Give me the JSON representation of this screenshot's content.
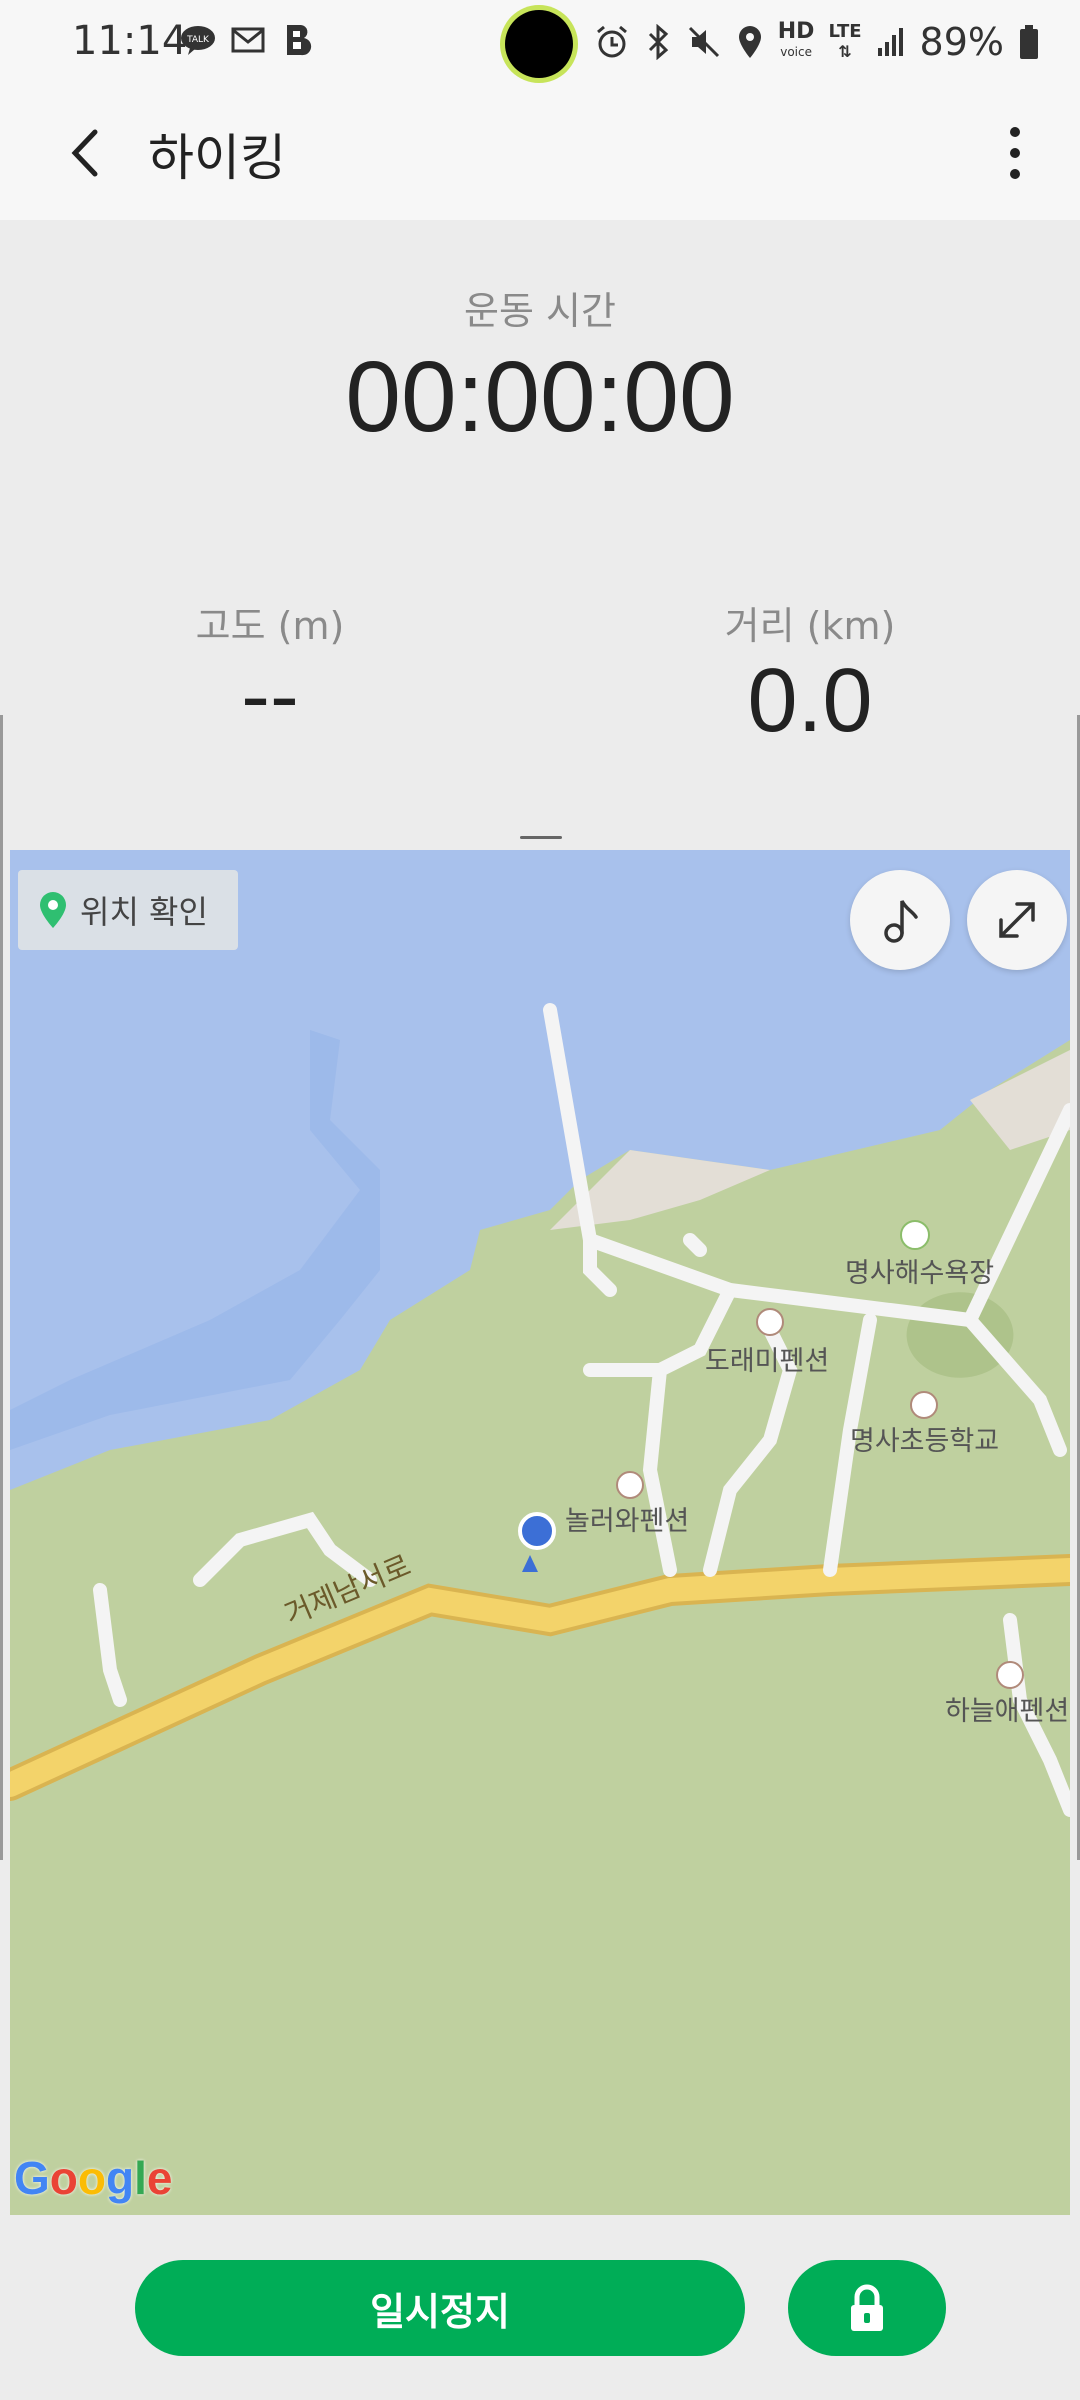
{
  "status_bar": {
    "time": "11:14",
    "battery": "89%",
    "hd_text": "HD",
    "voice_text": "voice",
    "lte_text": "LTE"
  },
  "app_bar": {
    "title": "하이킹"
  },
  "stats": {
    "workout_time_label": "운동 시간",
    "workout_time_value": "00:00:00",
    "altitude_label": "고도 (m)",
    "altitude_value": "--",
    "distance_label": "거리 (km)",
    "distance_value": "0.0"
  },
  "map": {
    "location_check_label": "위치 확인",
    "places": {
      "beach": "명사해수욕장",
      "pension1": "도래미펜션",
      "school": "명사초등학교",
      "pension2": "놀러와펜션",
      "pension3": "하늘애펜션",
      "road": "거제남서로"
    },
    "google_logo": "Google"
  },
  "bottom": {
    "pause_label": "일시정지"
  }
}
